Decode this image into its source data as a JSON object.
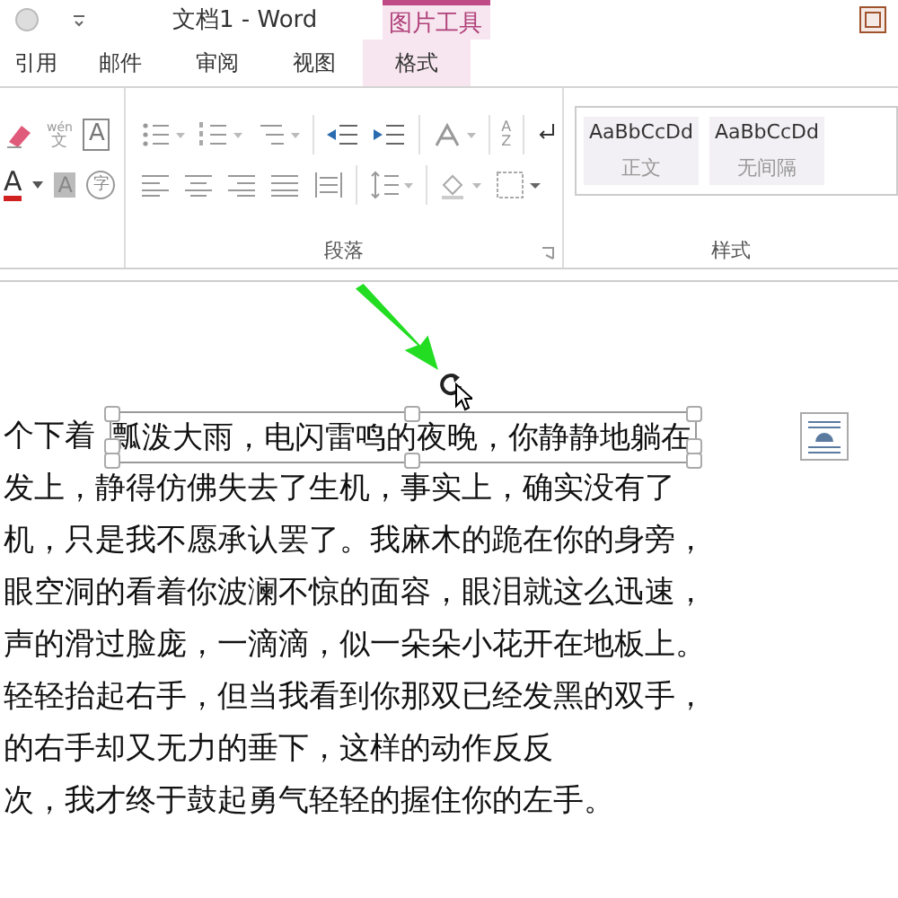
{
  "window": {
    "title": "文档1 - Word",
    "contextual_group": "图片工具"
  },
  "tabs": [
    {
      "label": "引用",
      "selected": false
    },
    {
      "label": "邮件",
      "selected": false
    },
    {
      "label": "审阅",
      "selected": false
    },
    {
      "label": "视图",
      "selected": false
    },
    {
      "label": "格式",
      "selected": true
    }
  ],
  "font_buttons": [
    {
      "kind": "clear"
    },
    {
      "kind": "phonetic",
      "ruby": "wén",
      "glyph": "文"
    },
    {
      "kind": "border",
      "glyph": "A"
    },
    {
      "kind": "color",
      "glyph": "A"
    },
    {
      "kind": "shade",
      "glyph": "A"
    },
    {
      "kind": "enclose",
      "glyph": "字"
    }
  ],
  "sort_button": {
    "top": "A",
    "bottom": "Z"
  },
  "paragraph_group": {
    "label": "段落"
  },
  "styles_group": {
    "label": "样式",
    "styles": [
      {
        "preview": "AaBbCcDd",
        "name": "正文"
      },
      {
        "preview": "AaBbCcDd",
        "name": "无间隔"
      }
    ]
  },
  "document": {
    "lines": [
      {
        "text": "个下着",
        "textbox": "瓢泼大雨，电闪雷鸣的夜晚，你静静地躺在",
        "selected": true
      },
      {
        "text": "发上，静得仿佛失去了生机，事实上，确实没有了"
      },
      {
        "text": "机，只是我不愿承认罢了。我麻木的跪在你的身旁，"
      },
      {
        "text": "眼空洞的看着你波澜不惊的面容，眼泪就这么迅速，"
      },
      {
        "text": "声的滑过脸庞，一滴滴，似一朵朵小花开在地板上。"
      },
      {
        "text": "轻轻抬起右手，但当我看到你那双已经发黑的双手，"
      },
      {
        "text": "的右手却又无力的垂下，这样的动作反反"
      },
      {
        "text": "次，我才终于鼓起勇气轻轻的握住你的左手。"
      }
    ]
  }
}
